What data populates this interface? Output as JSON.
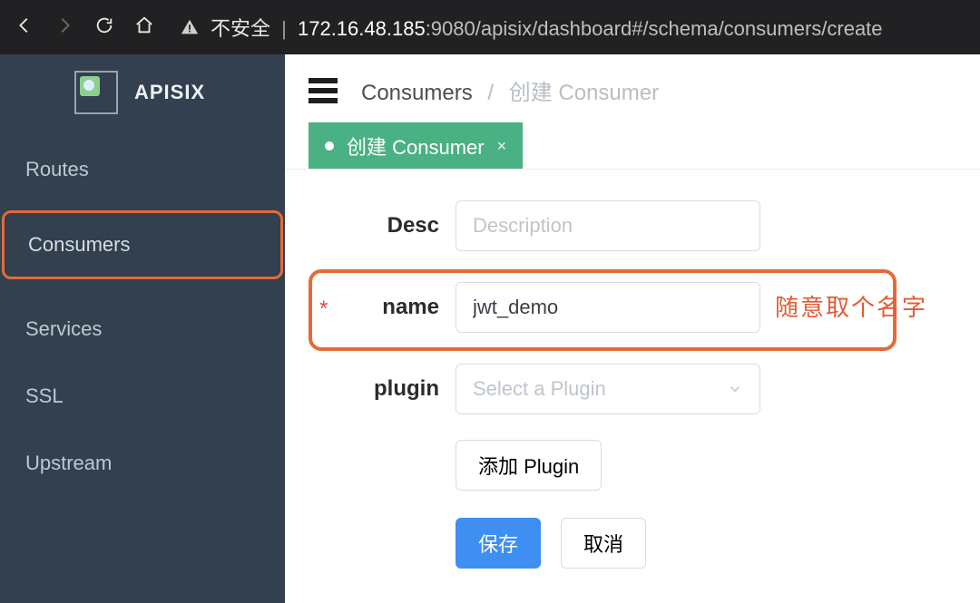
{
  "browser": {
    "insecure_label": "不安全",
    "url_host": "172.16.48.185",
    "url_rest": ":9080/apisix/dashboard#/schema/consumers/create"
  },
  "brand": {
    "title": "APISIX"
  },
  "sidebar": {
    "items": [
      {
        "label": "Routes"
      },
      {
        "label": "Consumers"
      },
      {
        "label": "Services"
      },
      {
        "label": "SSL"
      },
      {
        "label": "Upstream"
      }
    ]
  },
  "header": {
    "breadcrumb_root": "Consumers",
    "breadcrumb_current": "创建 Consumer"
  },
  "tab": {
    "label": "创建 Consumer"
  },
  "form": {
    "desc_label": "Desc",
    "desc_placeholder": "Description",
    "name_label": "name",
    "name_value": "jwt_demo",
    "name_hint": "随意取个名字",
    "plugin_label": "plugin",
    "plugin_placeholder": "Select a Plugin",
    "add_plugin_label": "添加 Plugin",
    "save_label": "保存",
    "cancel_label": "取消"
  }
}
